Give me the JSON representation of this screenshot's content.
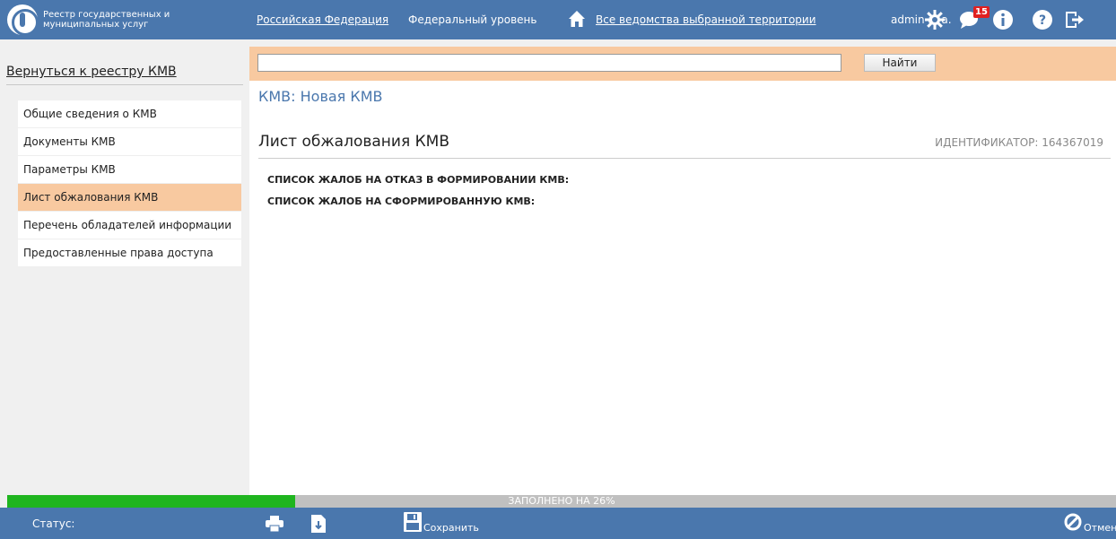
{
  "header": {
    "logo_text": "Реестр государственных и муниципальных услуг",
    "nav": {
      "territory": "Российская Федерация",
      "level": "Федеральный уровень",
      "departments": "Все ведомства выбранной территории"
    },
    "user": "admin a. a.",
    "notifications_count": "15"
  },
  "sidebar": {
    "back_link": "Вернуться к реестру КМВ",
    "items": [
      {
        "label": "Общие сведения о КМВ"
      },
      {
        "label": "Документы КМВ"
      },
      {
        "label": "Параметры КМВ"
      },
      {
        "label": "Лист обжалования КМВ",
        "active": true
      },
      {
        "label": "Перечень обладателей информации"
      },
      {
        "label": "Предоставленные права доступа"
      }
    ]
  },
  "search": {
    "value": "",
    "button": "Найти"
  },
  "main": {
    "breadcrumb": "КМВ: Новая КМВ",
    "title": "Лист обжалования КМВ",
    "identifier": "ИДЕНТИФИКАТОР: 164367019",
    "sections": [
      "СПИСОК ЖАЛОБ НА ОТКАЗ В ФОРМИРОВАНИИ КМВ:",
      "СПИСОК ЖАЛОБ НА СФОРМИРОВАННУЮ КМВ:"
    ]
  },
  "progress": {
    "text": "ЗАПОЛНЕНО НА 26%",
    "percent": 26
  },
  "footer": {
    "status_label": "Статус:",
    "save": "Сохранить",
    "cancel": "Отменить"
  },
  "colors": {
    "header_bg": "#4a77ad",
    "accent": "#f8c9a0",
    "progress": "#1fb51f"
  }
}
